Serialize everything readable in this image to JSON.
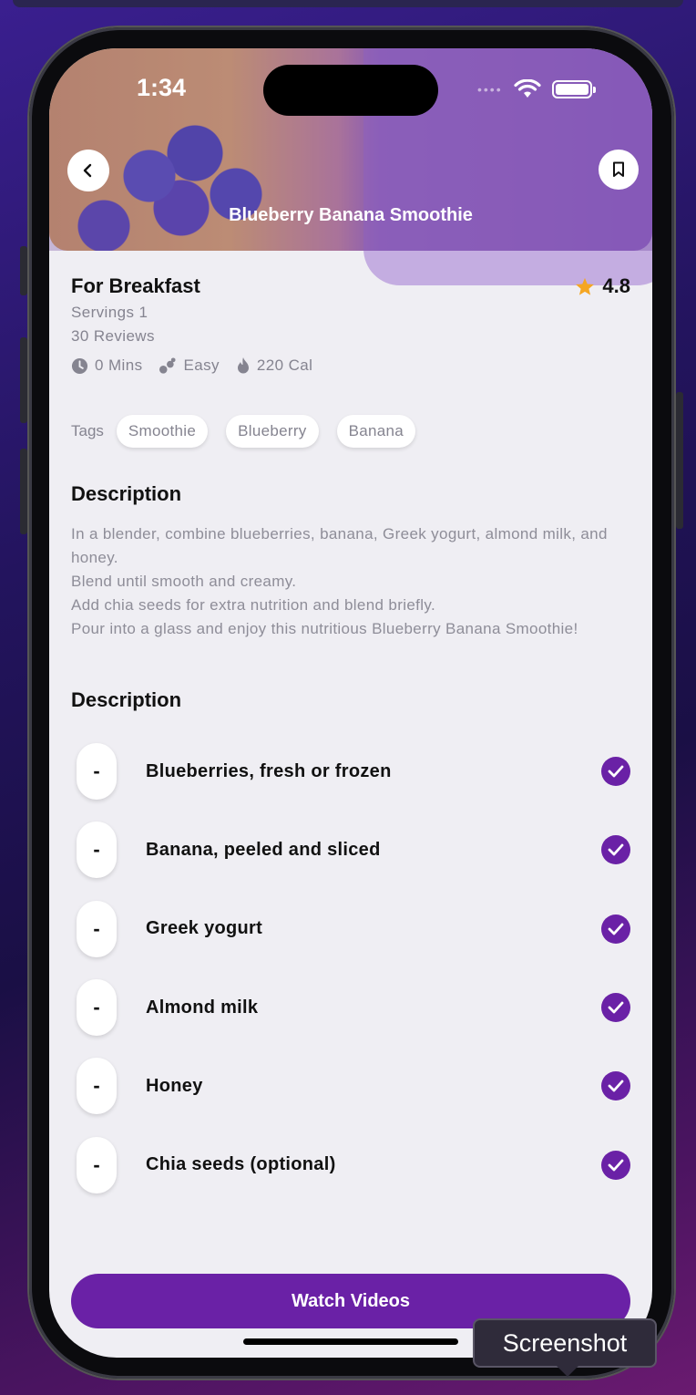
{
  "status_bar": {
    "time": "1:34"
  },
  "header": {
    "title": "Blueberry Banana Smoothie"
  },
  "recipe": {
    "meal": "For Breakfast",
    "rating": "4.8",
    "servings": "Servings 1",
    "reviews": "30 Reviews",
    "stats": {
      "time": "0 Mins",
      "difficulty": "Easy",
      "calories": "220 Cal"
    }
  },
  "tags": {
    "label": "Tags",
    "items": [
      "Smoothie",
      "Blueberry",
      "Banana"
    ]
  },
  "description": {
    "title": "Description",
    "lines": [
      "In a blender, combine blueberries, banana, Greek yogurt, almond milk, and honey.",
      "Blend until smooth and creamy.",
      "Add chia seeds for extra nutrition and blend briefly.",
      "Pour into a glass and enjoy this nutritious Blueberry Banana Smoothie!"
    ]
  },
  "ingredients": {
    "title": "Description",
    "minus_label": "-",
    "items": [
      "Blueberries, fresh or frozen",
      "Banana, peeled and sliced",
      "Greek yogurt",
      "Almond milk",
      "Honey",
      "Chia seeds (optional)"
    ]
  },
  "cta": {
    "label": "Watch Videos"
  },
  "tooltip": {
    "label": "Screenshot"
  },
  "colors": {
    "accent": "#6a21a6",
    "star": "#f5a623"
  }
}
